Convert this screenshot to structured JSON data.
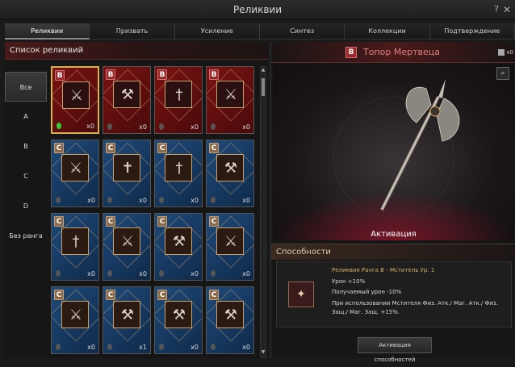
{
  "window": {
    "title": "Реликвии",
    "help": "?",
    "close": "✕"
  },
  "tabs": [
    "Реликвии",
    "Призвать",
    "Усиление",
    "Синтез",
    "Коллекции",
    "Подтверждение"
  ],
  "list": {
    "title": "Список реликвий",
    "filters": [
      "Все",
      "A",
      "B",
      "C",
      "D",
      "Без ранга"
    ],
    "cards": [
      {
        "rank": "B",
        "color": "red",
        "weapon": "⚔",
        "count": "x0",
        "gem": "green",
        "selected": true
      },
      {
        "rank": "B",
        "color": "red",
        "weapon": "⚒",
        "count": "x0",
        "gem": "grey"
      },
      {
        "rank": "B",
        "color": "red",
        "weapon": "†",
        "count": "x0",
        "gem": "grey"
      },
      {
        "rank": "B",
        "color": "red",
        "weapon": "⚔",
        "count": "x0",
        "gem": "grey"
      },
      {
        "rank": "C",
        "color": "blue",
        "weapon": "⚔",
        "count": "x0",
        "gem": "grey"
      },
      {
        "rank": "C",
        "color": "blue",
        "weapon": "✝",
        "count": "x0",
        "gem": "grey"
      },
      {
        "rank": "C",
        "color": "blue",
        "weapon": "†",
        "count": "x0",
        "gem": "grey"
      },
      {
        "rank": "C",
        "color": "blue",
        "weapon": "⚒",
        "count": "x0",
        "gem": "grey"
      },
      {
        "rank": "C",
        "color": "blue",
        "weapon": "†",
        "count": "x0",
        "gem": "grey"
      },
      {
        "rank": "C",
        "color": "blue",
        "weapon": "⚔",
        "count": "x0",
        "gem": "grey"
      },
      {
        "rank": "C",
        "color": "blue",
        "weapon": "⚒",
        "count": "x0",
        "gem": "grey"
      },
      {
        "rank": "C",
        "color": "blue",
        "weapon": "⚔",
        "count": "x0",
        "gem": "grey"
      },
      {
        "rank": "C",
        "color": "blue",
        "weapon": "⚔",
        "count": "x0",
        "gem": "grey"
      },
      {
        "rank": "C",
        "color": "blue",
        "weapon": "⚒",
        "count": "x1",
        "gem": "grey"
      },
      {
        "rank": "C",
        "color": "blue",
        "weapon": "⚒",
        "count": "x0",
        "gem": "grey"
      },
      {
        "rank": "C",
        "color": "blue",
        "weapon": "⚒",
        "count": "x0",
        "gem": "grey"
      }
    ]
  },
  "detail": {
    "rank": "B",
    "name": "Топор Мертвеца",
    "bag_count": "x0",
    "activation_label": "Активация",
    "abilities_title": "Способности",
    "ability_title": "Реликвия Ранга B - Мститель Ур. 1",
    "ability_lines": [
      "Урон +10%",
      "Получаемый урон -10%",
      "При использовании Мстителя Физ. Атк./ Маг. Атк./ Физ. Защ./ Маг. Защ. +15%."
    ],
    "activate_button": "Активация способностей"
  }
}
